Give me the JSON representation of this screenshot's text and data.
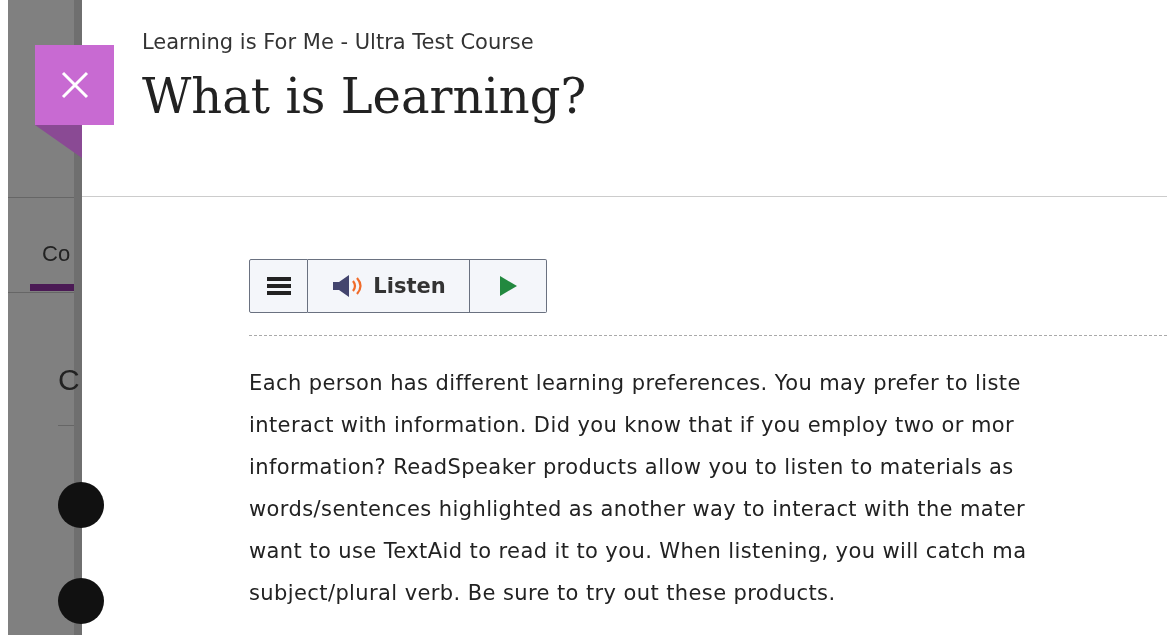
{
  "background_page": {
    "tab_label": "Co",
    "section_heading": "C"
  },
  "panel": {
    "course_name": "Learning is For Me - Ultra Test Course",
    "title": "What is Learning?",
    "readspeaker": {
      "listen_label": "Listen"
    },
    "paragraph_lines": [
      "Each person has different learning preferences. You may prefer to liste",
      "interact with information. Did you know that if you employ two or mor",
      "information? ReadSpeaker products allow you to listen to materials as",
      "words/sentences highlighted as another way to interact with the mater",
      "want to use TextAid to read it to you. When listening, you will catch ma",
      "subject/plural verb. Be sure to try out these products."
    ]
  }
}
